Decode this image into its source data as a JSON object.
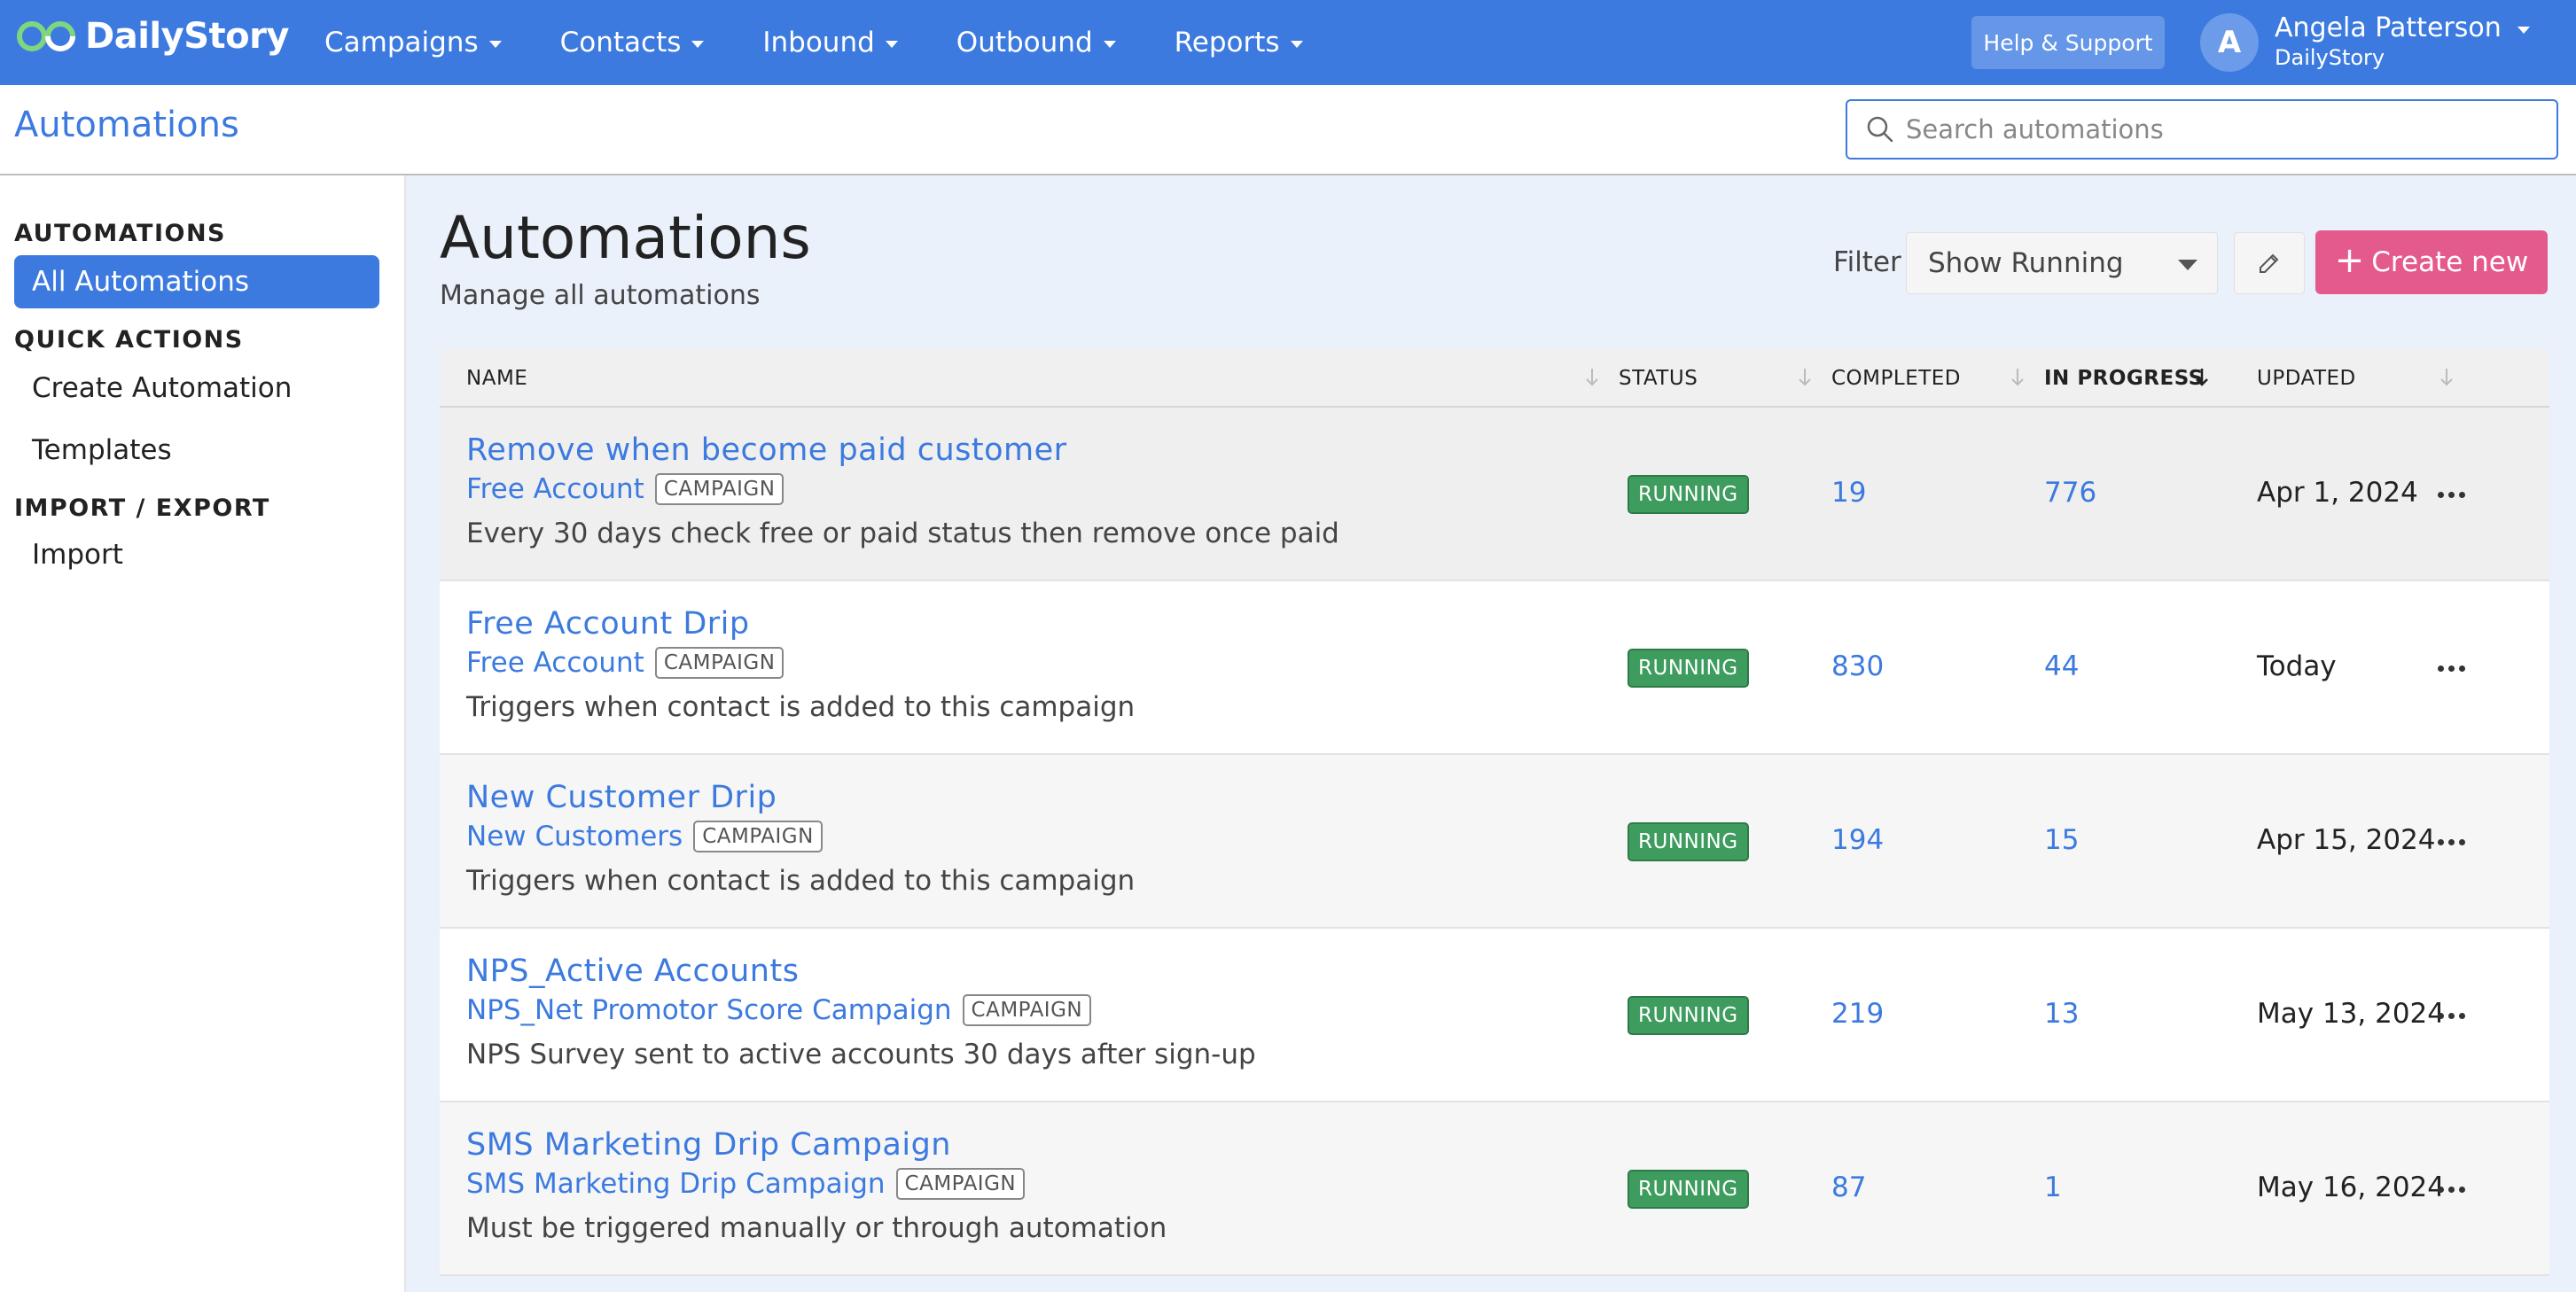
{
  "brand": {
    "name": "DailyStory"
  },
  "nav": {
    "items": [
      {
        "label": "Campaigns"
      },
      {
        "label": "Contacts"
      },
      {
        "label": "Inbound"
      },
      {
        "label": "Outbound"
      },
      {
        "label": "Reports"
      }
    ],
    "help_label": "Help & Support",
    "user": {
      "initial": "A",
      "name": "Angela Patterson",
      "org": "DailyStory"
    }
  },
  "header": {
    "title": "Automations",
    "search_placeholder": "Search automations"
  },
  "sidebar": {
    "sections": [
      {
        "heading": "AUTOMATIONS",
        "items": [
          {
            "label": "All Automations",
            "active": true
          }
        ]
      },
      {
        "heading": "QUICK ACTIONS",
        "items": [
          {
            "label": "Create Automation"
          },
          {
            "label": "Templates"
          }
        ]
      },
      {
        "heading": "IMPORT / EXPORT",
        "items": [
          {
            "label": "Import"
          }
        ]
      }
    ]
  },
  "main": {
    "title": "Automations",
    "subtitle": "Manage all automations",
    "filter_label": "Filter",
    "filter_value": "Show Running",
    "create_label": "Create new",
    "columns": [
      "NAME",
      "STATUS",
      "COMPLETED",
      "IN PROGRESS",
      "UPDATED"
    ],
    "rows": [
      {
        "name": "Remove when become paid customer",
        "campaign": "Free Account",
        "badge": "CAMPAIGN",
        "description": "Every 30 days check free or paid status then remove once paid",
        "status": "RUNNING",
        "completed": "19",
        "in_progress": "776",
        "updated": "Apr 1, 2024"
      },
      {
        "name": "Free Account Drip",
        "campaign": "Free Account",
        "badge": "CAMPAIGN",
        "description": "Triggers when contact is added to this campaign",
        "status": "RUNNING",
        "completed": "830",
        "in_progress": "44",
        "updated": "Today"
      },
      {
        "name": "New Customer Drip",
        "campaign": "New Customers",
        "badge": "CAMPAIGN",
        "description": "Triggers when contact is added to this campaign",
        "status": "RUNNING",
        "completed": "194",
        "in_progress": "15",
        "updated": "Apr 15, 2024"
      },
      {
        "name": "NPS_Active Accounts",
        "campaign": "NPS_Net Promotor Score Campaign",
        "badge": "CAMPAIGN",
        "description": "NPS Survey sent to active accounts 30 days after sign-up",
        "status": "RUNNING",
        "completed": "219",
        "in_progress": "13",
        "updated": "May 13, 2024"
      },
      {
        "name": "SMS Marketing Drip Campaign",
        "campaign": "SMS Marketing Drip Campaign",
        "badge": "CAMPAIGN",
        "description": "Must be triggered manually or through automation",
        "status": "RUNNING",
        "completed": "87",
        "in_progress": "1",
        "updated": "May 16, 2024"
      }
    ]
  },
  "colors": {
    "brand_blue": "#3c7ae0",
    "running_green": "#3f9c5f",
    "create_pink": "#e55a8c"
  }
}
